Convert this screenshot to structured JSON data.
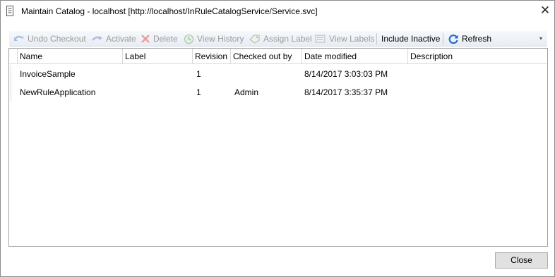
{
  "window": {
    "title": "Maintain Catalog - localhost [http://localhost/InRuleCatalogService/Service.svc]",
    "close_glyph": "✕"
  },
  "toolbar": {
    "undo_checkout": "Undo Checkout",
    "activate": "Activate",
    "delete": "Delete",
    "view_history": "View History",
    "assign_label": "Assign Label",
    "view_labels": "View Labels",
    "include_inactive": "Include Inactive",
    "refresh": "Refresh",
    "overflow_glyph": "▾",
    "colors": {
      "disabled_text": "#9a9a9a",
      "refresh_icon": "#2a6cc9",
      "delete_icon": "#e07070"
    }
  },
  "grid": {
    "columns": [
      "Name",
      "Label",
      "Revision",
      "Checked out by",
      "Date modified",
      "Description"
    ],
    "rows": [
      {
        "name": "InvoiceSample",
        "label": "",
        "revision": "1",
        "checked_out_by": "",
        "date_modified": "8/14/2017 3:03:03 PM",
        "description": ""
      },
      {
        "name": "NewRuleApplication",
        "label": "",
        "revision": "1",
        "checked_out_by": "Admin",
        "date_modified": "8/14/2017 3:35:37 PM",
        "description": ""
      }
    ]
  },
  "footer": {
    "close_label": "Close"
  }
}
